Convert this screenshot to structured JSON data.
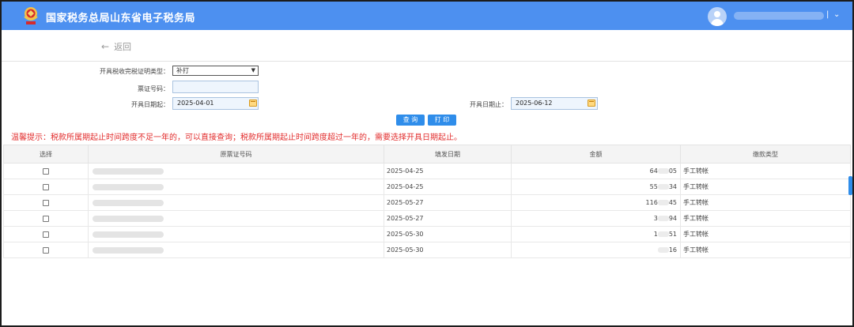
{
  "header": {
    "title": "国家税务总局山东省电子税务局",
    "user_sep": "|",
    "chevron": "⌄",
    "accent": "#4d90f0"
  },
  "nav": {
    "back_arrow": "←",
    "back_label": "返回"
  },
  "form": {
    "cert_type_label": "开具税收完税证明类型：",
    "cert_type_value": "补打",
    "cert_no_label": "票证号码：",
    "cert_no_value": "",
    "date_start_label": "开具日期起：",
    "date_start_value": "2025-04-01",
    "date_end_label": "开具日期止：",
    "date_end_value": "2025-06-12",
    "query_label": "查 询",
    "print_label": "打 印"
  },
  "tip": "温馨提示：税款所属期起止时间跨度不足一年的，可以直接查询；税款所属期起止时间跨度超过一年的，需要选择开具日期起止。",
  "table": {
    "headers": [
      "选择",
      "原票证号码",
      "填发日期",
      "金额",
      "缴款类型"
    ],
    "rows": [
      {
        "date": "2025-04-25",
        "amt_a": "64",
        "amt_b": "05",
        "type": "手工转帐"
      },
      {
        "date": "2025-04-25",
        "amt_a": "55",
        "amt_b": "34",
        "type": "手工转帐"
      },
      {
        "date": "2025-05-27",
        "amt_a": "116",
        "amt_b": "45",
        "type": "手工转帐"
      },
      {
        "date": "2025-05-27",
        "amt_a": "3",
        "amt_b": "94",
        "type": "手工转帐"
      },
      {
        "date": "2025-05-30",
        "amt_a": "1",
        "amt_b": "51",
        "type": "手工转帐"
      },
      {
        "date": "2025-05-30",
        "amt_a": "",
        "amt_b": "16",
        "type": "手工转帐"
      }
    ]
  },
  "colors": {
    "tip": "#e22d2d",
    "button": "#2f8dea"
  }
}
